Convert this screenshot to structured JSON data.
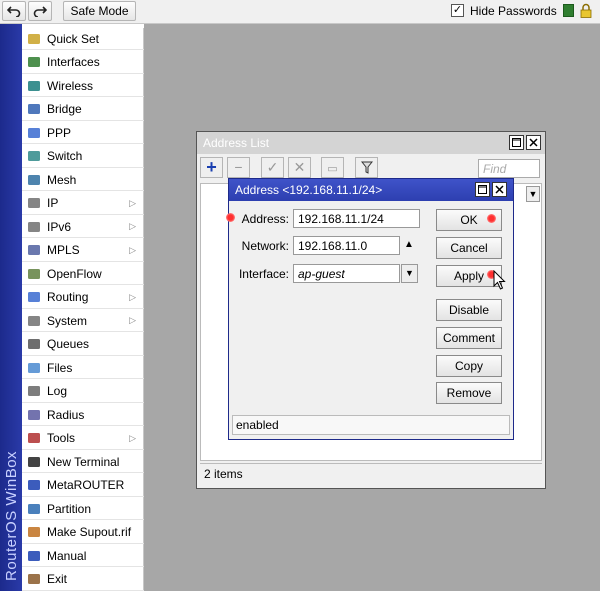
{
  "toolbar": {
    "undo_icon": "undo-icon",
    "redo_icon": "redo-icon",
    "safe_mode_label": "Safe Mode",
    "hide_passwords_label": "Hide Passwords",
    "hide_passwords_checked": "✓"
  },
  "banner": {
    "text": "RouterOS WinBox"
  },
  "sidebar": {
    "items": [
      {
        "label": "Quick Set",
        "icon": "quick-set-icon"
      },
      {
        "label": "Interfaces",
        "icon": "interfaces-icon"
      },
      {
        "label": "Wireless",
        "icon": "wireless-icon"
      },
      {
        "label": "Bridge",
        "icon": "bridge-icon"
      },
      {
        "label": "PPP",
        "icon": "ppp-icon"
      },
      {
        "label": "Switch",
        "icon": "switch-icon"
      },
      {
        "label": "Mesh",
        "icon": "mesh-icon"
      },
      {
        "label": "IP",
        "icon": "ip-icon"
      },
      {
        "label": "IPv6",
        "icon": "ipv6-icon"
      },
      {
        "label": "MPLS",
        "icon": "mpls-icon"
      },
      {
        "label": "OpenFlow",
        "icon": "openflow-icon"
      },
      {
        "label": "Routing",
        "icon": "routing-icon"
      },
      {
        "label": "System",
        "icon": "system-icon"
      },
      {
        "label": "Queues",
        "icon": "queues-icon"
      },
      {
        "label": "Files",
        "icon": "files-icon"
      },
      {
        "label": "Log",
        "icon": "log-icon"
      },
      {
        "label": "Radius",
        "icon": "radius-icon"
      },
      {
        "label": "Tools",
        "icon": "tools-icon"
      },
      {
        "label": "New Terminal",
        "icon": "terminal-icon"
      },
      {
        "label": "MetaROUTER",
        "icon": "metarouter-icon"
      },
      {
        "label": "Partition",
        "icon": "partition-icon"
      },
      {
        "label": "Make Supout.rif",
        "icon": "supout-icon"
      },
      {
        "label": "Manual",
        "icon": "manual-icon"
      },
      {
        "label": "Exit",
        "icon": "exit-icon"
      }
    ]
  },
  "address_list": {
    "title": "Address List",
    "find_placeholder": "Find",
    "status": "2 items"
  },
  "dialog": {
    "title": "Address <192.168.11.1/24>",
    "address_label": "Address:",
    "address_value": "192.168.11.1/24",
    "network_label": "Network:",
    "network_value": "192.168.11.0",
    "interface_label": "Interface:",
    "interface_value": "ap-guest",
    "buttons": {
      "ok": "OK",
      "cancel": "Cancel",
      "apply": "Apply",
      "disable": "Disable",
      "comment": "Comment",
      "copy": "Copy",
      "remove": "Remove"
    },
    "status": "enabled"
  },
  "colors": {
    "banner": "#1c2a8c",
    "dialog_title": "#3f53c9",
    "workspace": "#a7a7a7",
    "marker": "#ff3030"
  }
}
